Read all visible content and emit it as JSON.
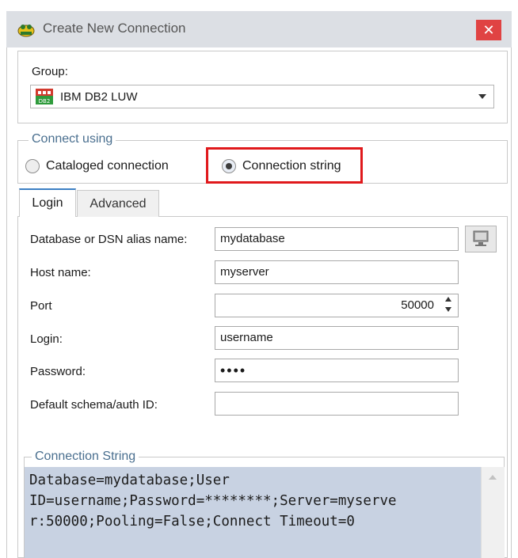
{
  "window": {
    "title": "Create New Connection",
    "close_glyph": "✕"
  },
  "group": {
    "label": "Group:",
    "selected": "IBM DB2 LUW",
    "icon": "db2-icon"
  },
  "connect_using": {
    "legend": "Connect using",
    "options": [
      {
        "label": "Cataloged connection",
        "selected": false
      },
      {
        "label": "Connection string",
        "selected": true
      }
    ]
  },
  "tabs": [
    {
      "label": "Login",
      "active": true
    },
    {
      "label": "Advanced",
      "active": false
    }
  ],
  "form": {
    "database_label": "Database or DSN alias name:",
    "database_value": "mydatabase",
    "host_label": "Host name:",
    "host_value": "myserver",
    "port_label": "Port",
    "port_value": "50000",
    "login_label": "Login:",
    "login_value": "username",
    "password_label": "Password:",
    "password_value": "••••",
    "schema_label": "Default schema/auth ID:",
    "schema_value": ""
  },
  "connection_string": {
    "legend": "Connection String",
    "text": "Database=mydatabase;User\nID=username;Password=********;Server=myserve\nr:50000;Pooling=False;Connect Timeout=0"
  },
  "colors": {
    "highlight": "#e0191c",
    "close_button": "#e04343",
    "text_area": "#c8d2e2",
    "legend_text": "#4a6f8f"
  }
}
